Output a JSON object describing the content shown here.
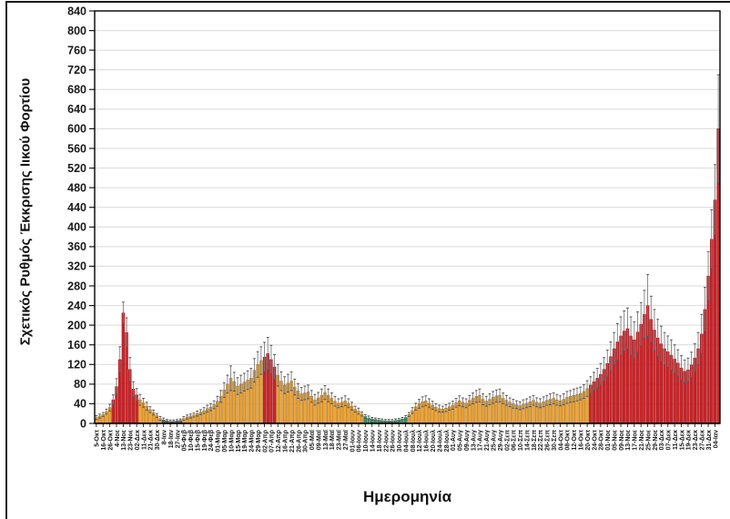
{
  "chart_data": {
    "type": "bar",
    "title": "",
    "ylabel": "Σχετικός Ρυθμός Έκκρισης Ιικού Φορτίου",
    "xlabel": "Ημερομηνία",
    "ylim": [
      0,
      840
    ],
    "ytick_step": 40,
    "grid": true,
    "legend": "none",
    "error_bars": true,
    "tick_every_n_bars": 2,
    "tick_labels": [
      "5-Οκτ",
      "16-Οκτ",
      "26-Οκτ",
      "4-Νοε",
      "13-Νοε",
      "23-Νοε",
      "02-Δεκ",
      "11-Δεκ",
      "21-Δεκ",
      "30-Δεκ",
      "8-Ιαν",
      "18-Ιαν",
      "27-Ιαν",
      "05-Φεβ",
      "10-Φεβ",
      "15-Φεβ",
      "19-Φεβ",
      "24-Φεβ",
      "01-Μαρ",
      "05-Μαρ",
      "10-Μαρ",
      "15-Μαρ",
      "19-Μαρ",
      "24-Μαρ",
      "29-Μαρ",
      "02-Απρ",
      "07-Απρ",
      "12-Απρ",
      "16-Απρ",
      "21-Απρ",
      "26-Απρ",
      "30-Απρ",
      "05-Μαϊ",
      "09-Μαϊ",
      "13-Μαϊ",
      "18-Μαϊ",
      "23-Μαϊ",
      "27-Μαϊ",
      "01-Ιουν",
      "06-Ιουν",
      "10-Ιουν",
      "14-Ιουν",
      "18-Ιουν",
      "22-Ιουν",
      "26-Ιουν",
      "30-Ιουν",
      "04-Ιουλ",
      "08-Ιουλ",
      "12-Ιουλ",
      "16-Ιουλ",
      "20-Ιουλ",
      "24-Ιουλ",
      "28-Ιουλ",
      "01-Αυγ",
      "05-Αυγ",
      "09-Αυγ",
      "13-Αυγ",
      "17-Αυγ",
      "21-Αυγ",
      "25-Αυγ",
      "29-Αυγ",
      "02-Σεπ",
      "06-Σεπ",
      "10-Σεπ",
      "14-Σεπ",
      "18-Σεπ",
      "22-Σεπ",
      "26-Σεπ",
      "30-Σεπ",
      "04-Οκτ",
      "08-Οκτ",
      "12-Οκτ",
      "16-Οκτ",
      "20-Οκτ",
      "24-Οκτ",
      "28-Οκτ",
      "01-Νοε",
      "05-Νοε",
      "09-Νοε",
      "13-Νοε",
      "17-Νοε",
      "21-Νοε",
      "25-Νοε",
      "29-Νοε",
      "03-Δεκ",
      "07-Δεκ",
      "11-Δεκ",
      "15-Δεκ",
      "19-Δεκ",
      "23-Δεκ",
      "27-Δεκ",
      "31-Δεκ",
      "04-Ιαν"
    ],
    "palette": {
      "r": {
        "fill": "#cf2429",
        "stroke": "#8f1418"
      },
      "o": {
        "fill": "#f1a433",
        "stroke": "#a9731c"
      },
      "g": {
        "fill": "#2f9e6f",
        "stroke": "#1d6a49"
      },
      "d": {
        "fill": "#555e57",
        "stroke": "#2e342f"
      }
    },
    "error_bar_line_color": "#7d7d7d",
    "error_bar_cap_color": "#555555",
    "gridline_color": "#d9d9d9",
    "plot_border_color": "#000000",
    "bars": {
      "colors": "ooooorrrrrrrrooooooodddddd oooooooooooooooooooooooorrrroooooooooooooooooooooooooogggggggggggggoooooooooooooooooooooooooooooooooooooooooooooooooooooorrrrrrrrrrrrrrrrrrrrrrrrrrrrrrrrrrrrrrr",
      "values": [
        12,
        15,
        18,
        24,
        32,
        48,
        75,
        130,
        225,
        185,
        110,
        70,
        58,
        48,
        42,
        35,
        28,
        22,
        16,
        10,
        7,
        5,
        4,
        4,
        5,
        6,
        10,
        13,
        15,
        17,
        20,
        23,
        26,
        30,
        33,
        38,
        45,
        55,
        68,
        80,
        92,
        85,
        76,
        80,
        84,
        88,
        92,
        108,
        120,
        128,
        135,
        142,
        130,
        115,
        98,
        86,
        78,
        82,
        86,
        74,
        66,
        60,
        62,
        64,
        55,
        48,
        52,
        57,
        63,
        57,
        51,
        45,
        41,
        43,
        46,
        41,
        35,
        29,
        25,
        19,
        14,
        11,
        9,
        8,
        7,
        6,
        5,
        5,
        5,
        6,
        7,
        9,
        12,
        18,
        26,
        34,
        40,
        44,
        46,
        41,
        37,
        33,
        30,
        29,
        31,
        34,
        37,
        42,
        46,
        43,
        41,
        47,
        51,
        55,
        57,
        49,
        45,
        49,
        53,
        56,
        57,
        51,
        47,
        43,
        40,
        38,
        36,
        39,
        41,
        44,
        47,
        43,
        41,
        44,
        47,
        49,
        51,
        48,
        46,
        49,
        53,
        55,
        57,
        59,
        61,
        65,
        71,
        78,
        85,
        92,
        100,
        110,
        122,
        136,
        152,
        166,
        178,
        188,
        193,
        178,
        170,
        186,
        202,
        222,
        240,
        212,
        190,
        174,
        162,
        152,
        146,
        139,
        131,
        123,
        113,
        106,
        109,
        119,
        133,
        152,
        182,
        232,
        300,
        375,
        455,
        600
      ],
      "errors": [
        4,
        4,
        4,
        5,
        7,
        10,
        16,
        26,
        22,
        30,
        24,
        15,
        13,
        11,
        9,
        8,
        6,
        5,
        4,
        4,
        4,
        3,
        3,
        3,
        3,
        3,
        4,
        4,
        4,
        4,
        5,
        5,
        6,
        7,
        7,
        8,
        10,
        12,
        15,
        18,
        25,
        19,
        17,
        18,
        18,
        19,
        20,
        24,
        26,
        28,
        30,
        33,
        29,
        25,
        22,
        19,
        17,
        18,
        19,
        16,
        15,
        13,
        14,
        14,
        12,
        11,
        11,
        13,
        14,
        13,
        11,
        10,
        9,
        9,
        10,
        9,
        8,
        6,
        6,
        4,
        4,
        4,
        3,
        3,
        3,
        3,
        3,
        3,
        3,
        3,
        3,
        3,
        4,
        4,
        6,
        7,
        9,
        10,
        10,
        9,
        8,
        7,
        7,
        6,
        7,
        7,
        8,
        9,
        10,
        9,
        9,
        10,
        11,
        12,
        13,
        11,
        10,
        11,
        12,
        12,
        13,
        11,
        10,
        9,
        9,
        8,
        8,
        9,
        9,
        10,
        10,
        9,
        9,
        10,
        10,
        11,
        11,
        11,
        10,
        11,
        12,
        12,
        13,
        13,
        13,
        14,
        16,
        17,
        19,
        20,
        22,
        24,
        27,
        30,
        33,
        37,
        39,
        41,
        42,
        39,
        37,
        41,
        44,
        49,
        63,
        47,
        42,
        38,
        36,
        33,
        32,
        31,
        29,
        27,
        25,
        23,
        24,
        26,
        29,
        33,
        40,
        45,
        50,
        60,
        72,
        110
      ]
    }
  }
}
